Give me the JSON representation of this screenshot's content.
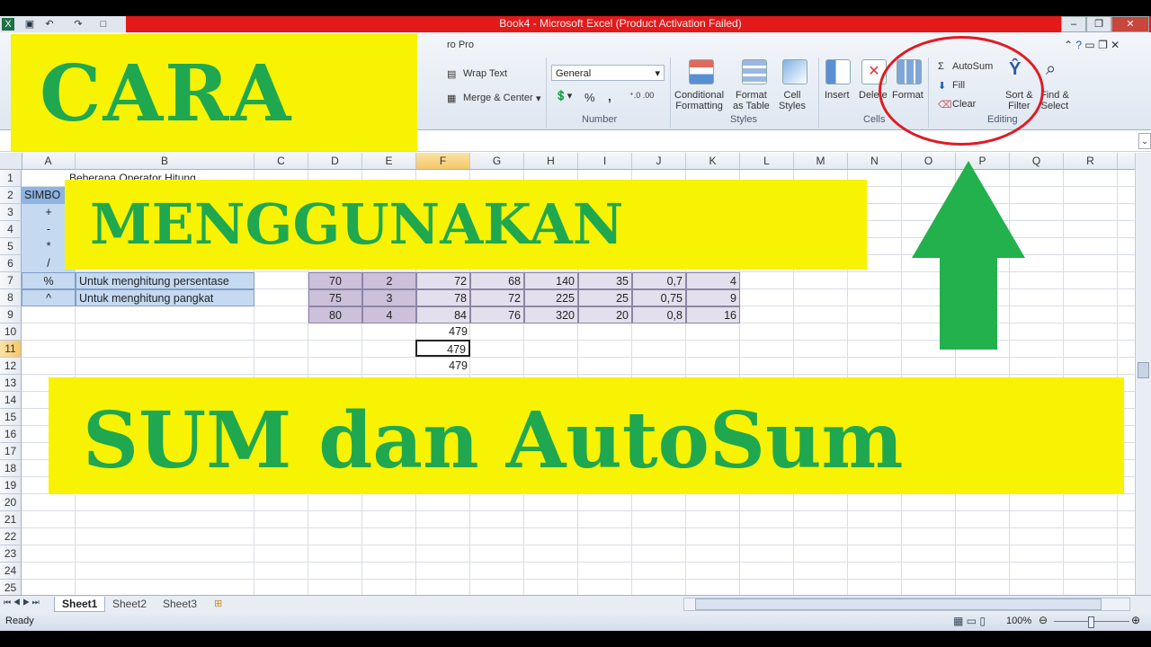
{
  "window": {
    "title": "Book4 - Microsoft Excel (Product Activation Failed)",
    "partial_tab": "ro Pro"
  },
  "ribbon": {
    "wrap_text": "Wrap Text",
    "merge_center": "Merge & Center",
    "number_format": "General",
    "number_group": "Number",
    "percent": "%",
    "comma": ",",
    "cond_format": "Conditional\nFormatting",
    "format_table": "Format\nas Table",
    "cell_styles": "Cell\nStyles",
    "styles_group": "Styles",
    "insert": "Insert",
    "delete": "Delete",
    "format": "Format",
    "cells_group": "Cells",
    "autosum": "AutoSum",
    "fill": "Fill",
    "clear": "Clear",
    "sort_filter": "Sort &\nFilter",
    "find_select": "Find &\nSelect",
    "editing_group": "Editing"
  },
  "columns": [
    "A",
    "B",
    "C",
    "D",
    "E",
    "F",
    "G",
    "H",
    "I",
    "J",
    "K",
    "L",
    "M",
    "N",
    "O",
    "P",
    "Q",
    "R"
  ],
  "rows": [
    "1",
    "2",
    "3",
    "4",
    "5",
    "6",
    "7",
    "8",
    "9",
    "10",
    "11",
    "12",
    "13",
    "14",
    "15",
    "16",
    "17",
    "18",
    "19",
    "20",
    "21",
    "22",
    "23",
    "24",
    "25"
  ],
  "sheet": {
    "b1": "Beberapa Operator Hitung",
    "a2": "SIMBO",
    "a3": "+",
    "a4": "-",
    "a5": "*",
    "a6": "/",
    "a7": "%",
    "b7": "Untuk menghitung persentase",
    "a8": "^",
    "b8": "Untuk menghitung pangkat",
    "r7": [
      "70",
      "2",
      "72",
      "68",
      "140",
      "35",
      "0,7",
      "4"
    ],
    "r8": [
      "75",
      "3",
      "78",
      "72",
      "225",
      "25",
      "0,75",
      "9"
    ],
    "r9": [
      "80",
      "4",
      "84",
      "76",
      "320",
      "20",
      "0,8",
      "16"
    ],
    "f10": "479",
    "f11": "479",
    "f12": "479"
  },
  "sheet_tabs": [
    "Sheet1",
    "Sheet2",
    "Sheet3"
  ],
  "status": {
    "ready": "Ready",
    "zoom": "100%"
  },
  "overlay": {
    "line1": "CARA",
    "line2": "MENGGUNAKAN",
    "line3": "SUM dan AutoSum"
  },
  "colors": {
    "banner_yellow": "#f7f303",
    "text_green": "#1fa84f",
    "arrow_green": "#22b14c",
    "circle_red": "#e01b24",
    "header_blue": "#8db4e2",
    "cell_blue": "#c5d9f1",
    "cell_purple": "#ccc0da",
    "cell_lilac": "#e4dfec"
  }
}
